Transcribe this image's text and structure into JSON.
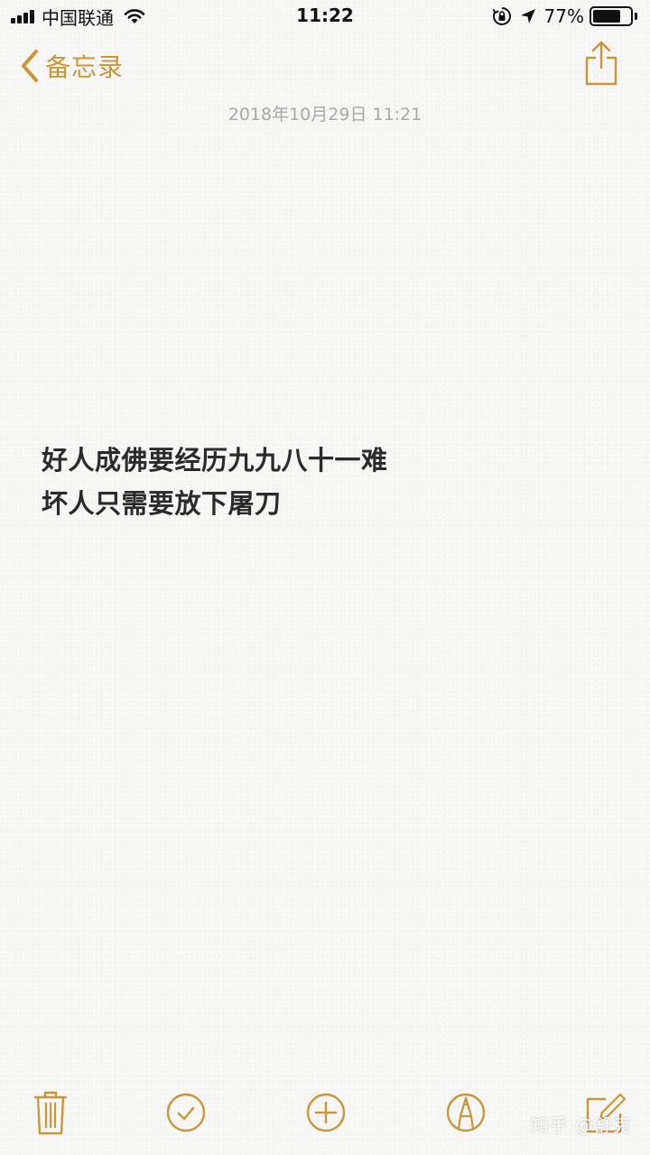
{
  "status_bar": {
    "carrier": "中国联通",
    "time": "11:22",
    "battery_percent": "77%",
    "battery_level": 0.77
  },
  "nav": {
    "back_label": "备忘录",
    "accent_color": "#c9963a"
  },
  "note": {
    "date": "2018年10月29日 11:21",
    "lines": [
      "好人成佛要经历九九八十一难",
      "坏人只需要放下屠刀"
    ]
  },
  "toolbar": {
    "icons": [
      "trash-icon",
      "checklist-icon",
      "add-icon",
      "markup-icon",
      "compose-icon"
    ]
  },
  "watermark": {
    "text": "知乎 @舒克"
  }
}
